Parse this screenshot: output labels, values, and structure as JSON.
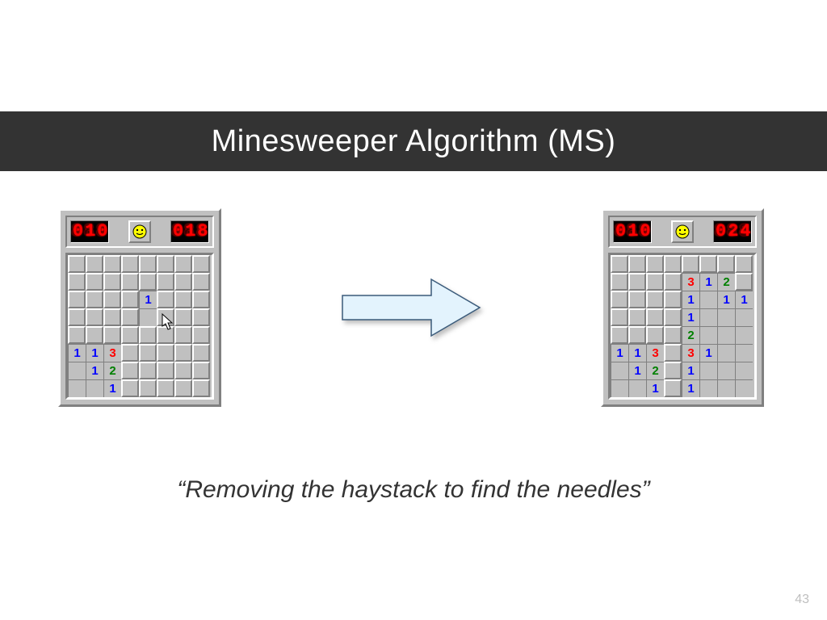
{
  "title": "Minesweeper Algorithm (MS)",
  "quote": "“Removing the haystack to find the needles”",
  "page_number": "43",
  "colors": {
    "title_bg": "#333333",
    "arrow_fill": "#e3f3fd",
    "arrow_stroke": "#3a5a7a"
  },
  "left_board": {
    "mine_counter": "010",
    "time_counter": "018",
    "cursor": {
      "row": 3,
      "col": 5
    },
    "grid": [
      [
        "u",
        "u",
        "u",
        "u",
        "u",
        "u",
        "u",
        "u"
      ],
      [
        "u",
        "u",
        "u",
        "u",
        "u",
        "u",
        "u",
        "u"
      ],
      [
        "u",
        "u",
        "u",
        "u",
        "1",
        "u",
        "u",
        "u"
      ],
      [
        "u",
        "u",
        "u",
        "u",
        "r",
        "u",
        "u",
        "u"
      ],
      [
        "u",
        "u",
        "u",
        "u",
        "u",
        "u",
        "u",
        "u"
      ],
      [
        "1",
        "1",
        "3",
        "u",
        "u",
        "u",
        "u",
        "u"
      ],
      [
        "r",
        "1",
        "2",
        "u",
        "u",
        "u",
        "u",
        "u"
      ],
      [
        "r",
        "r",
        "1",
        "u",
        "u",
        "u",
        "u",
        "u"
      ]
    ]
  },
  "right_board": {
    "mine_counter": "010",
    "time_counter": "024",
    "grid": [
      [
        "u",
        "u",
        "u",
        "u",
        "u",
        "u",
        "u",
        "u"
      ],
      [
        "u",
        "u",
        "u",
        "u",
        "3",
        "1",
        "2",
        "u"
      ],
      [
        "u",
        "u",
        "u",
        "u",
        "1",
        "r",
        "1",
        "1"
      ],
      [
        "u",
        "u",
        "u",
        "u",
        "1",
        "r",
        "r",
        "r"
      ],
      [
        "u",
        "u",
        "u",
        "u",
        "2",
        "r",
        "r",
        "r"
      ],
      [
        "1",
        "1",
        "3",
        "u",
        "3",
        "1",
        "r",
        "r"
      ],
      [
        "r",
        "1",
        "2",
        "u",
        "1",
        "r",
        "r",
        "r"
      ],
      [
        "r",
        "r",
        "1",
        "u",
        "1",
        "r",
        "r",
        "r"
      ]
    ]
  }
}
